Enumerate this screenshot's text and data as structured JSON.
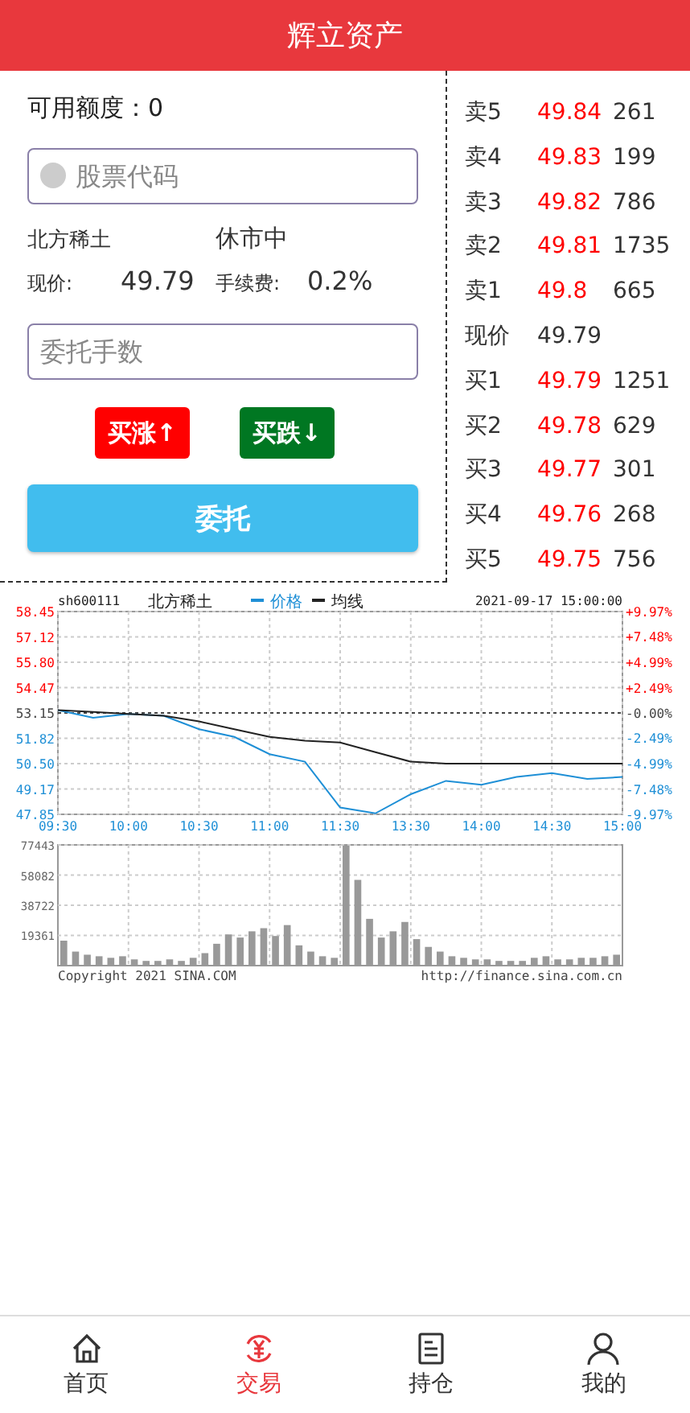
{
  "header": {
    "title": "辉立资产"
  },
  "trade_form": {
    "available": {
      "label": "可用额度：",
      "value": "0"
    },
    "stock_field": {
      "placeholder": "股票代码"
    },
    "stock_name": "北方稀土",
    "market_status": "休市中",
    "price": {
      "label": "现价:",
      "value": "49.79"
    },
    "fee": {
      "label": "手续费:",
      "value": "0.2%"
    },
    "lots_field": {
      "placeholder": "委托手数"
    },
    "buttons": [
      {
        "label": "买涨↑",
        "kind": "up"
      },
      {
        "label": "买跌↓",
        "kind": "down"
      }
    ],
    "submit": "委托"
  },
  "order_book": [
    {
      "label": "卖5",
      "price": "49.84",
      "volume": "261",
      "kind": "quote"
    },
    {
      "label": "卖4",
      "price": "49.83",
      "volume": "199",
      "kind": "quote"
    },
    {
      "label": "卖3",
      "price": "49.82",
      "volume": "786",
      "kind": "quote"
    },
    {
      "label": "卖2",
      "price": "49.81",
      "volume": "1735",
      "kind": "quote"
    },
    {
      "label": "卖1",
      "price": "49.8",
      "volume": "665",
      "kind": "quote"
    },
    {
      "label": "现价",
      "price": "49.79",
      "kind": "current"
    },
    {
      "label": "买1",
      "price": "49.79",
      "volume": "1251",
      "kind": "quote"
    },
    {
      "label": "买2",
      "price": "49.78",
      "volume": "629",
      "kind": "quote"
    },
    {
      "label": "买3",
      "price": "49.77",
      "volume": "301",
      "kind": "quote"
    },
    {
      "label": "买4",
      "price": "49.76",
      "volume": "268",
      "kind": "quote"
    },
    {
      "label": "买5",
      "price": "49.75",
      "volume": "756",
      "kind": "quote"
    }
  ],
  "chart": {
    "code": "sh600111",
    "name": "北方稀土",
    "timestamp": "2021-09-17 15:00:00",
    "price_chart": {
      "chart_data": {
        "type": "line",
        "categories": [
          "09:30",
          null,
          "10:00",
          null,
          "10:30",
          null,
          "11:00",
          null,
          "11:30",
          null,
          "13:30",
          null,
          "14:00",
          null,
          "14:30",
          null,
          "15:00"
        ],
        "grid": true,
        "series": [
          {
            "name": "价格",
            "color": "#1e8fd6",
            "values": [
              53.3,
              52.9,
              53.1,
              53.0,
              52.3,
              51.9,
              51.0,
              50.6,
              48.2,
              47.9,
              48.9,
              49.6,
              49.4,
              49.8,
              50.0,
              49.7,
              49.8
            ]
          },
          {
            "name": "均线",
            "color": "#222222",
            "values": [
              53.3,
              53.2,
              53.1,
              53.0,
              52.7,
              52.3,
              51.9,
              51.7,
              51.6,
              51.1,
              50.6,
              50.5,
              50.5,
              50.5,
              50.5,
              50.5,
              50.5
            ]
          }
        ],
        "ylim": [
          47.85,
          58.45
        ],
        "y2lim": [
          -9.97,
          9.97
        ],
        "yticks": [
          {
            "value": 58.45,
            "label": "58.45"
          },
          {
            "value": 57.12,
            "label": "57.12"
          },
          {
            "value": 55.8,
            "label": "55.80"
          },
          {
            "value": 54.47,
            "label": "54.47"
          },
          {
            "value": 53.15,
            "label": "53.15"
          },
          {
            "value": 51.82,
            "label": "51.82"
          },
          {
            "value": 50.5,
            "label": "50.50"
          },
          {
            "value": 49.17,
            "label": "49.17"
          },
          {
            "value": 47.85,
            "label": "47.85"
          }
        ],
        "y2ticks": [
          {
            "value": 9.97,
            "label": "+9.97%"
          },
          {
            "value": 7.48,
            "label": "+7.48%"
          },
          {
            "value": 4.99,
            "label": "+4.99%"
          },
          {
            "value": 2.49,
            "label": "+2.49%"
          },
          {
            "value": 0,
            "label": "-0.00%"
          },
          {
            "value": -2.49,
            "label": "-2.49%"
          },
          {
            "value": -4.99,
            "label": "-4.99%"
          },
          {
            "value": -7.48,
            "label": "-7.48%"
          },
          {
            "value": -9.97,
            "label": "-9.97%"
          }
        ],
        "ref_lines": [
          {
            "axis": "y",
            "value": 53.15
          }
        ],
        "legend": "top"
      }
    },
    "volume_chart": {
      "chart_data": {
        "type": "bar",
        "grid": true,
        "ylim": [
          0,
          77443
        ],
        "yticks": [
          {
            "value": 19361,
            "label": "19361"
          },
          {
            "value": 38722,
            "label": "38722"
          },
          {
            "value": 58082,
            "label": "58082"
          },
          {
            "value": 77443,
            "label": "77443"
          }
        ],
        "values": [
          16000,
          9000,
          7000,
          6000,
          5000,
          6000,
          4000,
          3000,
          3000,
          4000,
          3000,
          5000,
          8000,
          14000,
          20000,
          18000,
          22000,
          24000,
          19000,
          26000,
          13000,
          9000,
          6000,
          5000,
          77000,
          55000,
          30000,
          18000,
          22000,
          28000,
          17000,
          12000,
          9000,
          6000,
          5000,
          4000,
          4000,
          3000,
          3000,
          3000,
          5000,
          6000,
          4000,
          4000,
          5000,
          5000,
          6000,
          7000
        ]
      }
    },
    "copyright": "Copyright 2021 SINA.COM",
    "source": "http://finance.sina.com.cn"
  },
  "tab_bar": [
    {
      "label": "首页",
      "kind": "home",
      "selected": false
    },
    {
      "label": "交易",
      "kind": "trade",
      "selected": true
    },
    {
      "label": "持仓",
      "kind": "holdings",
      "selected": false
    },
    {
      "label": "我的",
      "kind": "profile",
      "selected": false
    }
  ]
}
